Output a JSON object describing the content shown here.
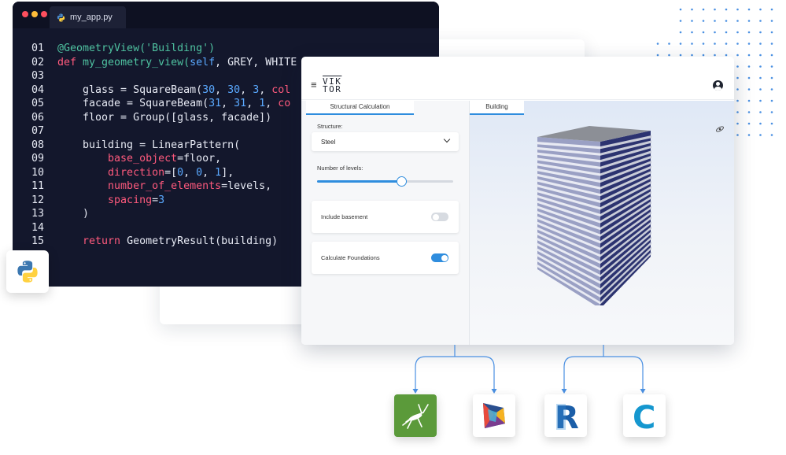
{
  "editor": {
    "filename": "my_app.py",
    "window_dots": [
      "#ff5f57",
      "#febc2e",
      "#28c840"
    ],
    "lines": [
      {
        "n": "01",
        "tokens": [
          [
            "dec",
            "@GeometryView("
          ],
          [
            "str",
            "'Building'"
          ],
          [
            "dec",
            ")"
          ]
        ]
      },
      {
        "n": "02",
        "tokens": [
          [
            "kw",
            "def "
          ],
          [
            "dec",
            "my_geometry_view("
          ],
          [
            "self",
            "self"
          ],
          [
            "txt",
            ", GREY, WHITE"
          ]
        ]
      },
      {
        "n": "03",
        "tokens": []
      },
      {
        "n": "04",
        "tokens": [
          [
            "txt",
            "    glass = SquareBeam("
          ],
          [
            "num",
            "30"
          ],
          [
            "txt",
            ", "
          ],
          [
            "num",
            "30"
          ],
          [
            "txt",
            ", "
          ],
          [
            "num",
            "3"
          ],
          [
            "txt",
            ", "
          ],
          [
            "prm",
            "col"
          ]
        ]
      },
      {
        "n": "05",
        "tokens": [
          [
            "txt",
            "    facade = SquareBeam("
          ],
          [
            "num",
            "31"
          ],
          [
            "txt",
            ", "
          ],
          [
            "num",
            "31"
          ],
          [
            "txt",
            ", "
          ],
          [
            "num",
            "1"
          ],
          [
            "txt",
            ", "
          ],
          [
            "prm",
            "co"
          ]
        ]
      },
      {
        "n": "06",
        "tokens": [
          [
            "txt",
            "    floor = Group([glass, facade])"
          ]
        ]
      },
      {
        "n": "07",
        "tokens": []
      },
      {
        "n": "08",
        "tokens": [
          [
            "txt",
            "    building = LinearPattern("
          ]
        ]
      },
      {
        "n": "09",
        "tokens": [
          [
            "prm",
            "        base_object"
          ],
          [
            "txt",
            "=floor,"
          ]
        ]
      },
      {
        "n": "10",
        "tokens": [
          [
            "prm",
            "        direction"
          ],
          [
            "txt",
            "=["
          ],
          [
            "num",
            "0"
          ],
          [
            "txt",
            ", "
          ],
          [
            "num",
            "0"
          ],
          [
            "txt",
            ", "
          ],
          [
            "num",
            "1"
          ],
          [
            "txt",
            "],"
          ]
        ]
      },
      {
        "n": "11",
        "tokens": [
          [
            "prm",
            "        number_of_elements"
          ],
          [
            "txt",
            "=levels,"
          ]
        ]
      },
      {
        "n": "12",
        "tokens": [
          [
            "prm",
            "        spacing"
          ],
          [
            "txt",
            "="
          ],
          [
            "num",
            "3"
          ]
        ]
      },
      {
        "n": "13",
        "tokens": [
          [
            "txt",
            "    )"
          ]
        ]
      },
      {
        "n": "14",
        "tokens": []
      },
      {
        "n": "15",
        "tokens": [
          [
            "kw",
            "    return "
          ],
          [
            "txt",
            "GeometryResult(building)"
          ]
        ]
      }
    ]
  },
  "app": {
    "logo_line1": "VIK",
    "logo_line2": "TOR",
    "tabs": {
      "left": "Structural Calculation",
      "right": "Building"
    },
    "structure": {
      "label": "Structure:",
      "value": "Steel"
    },
    "levels": {
      "label": "Number of levels:",
      "fraction": 0.62
    },
    "include_basement": {
      "label": "Include basement",
      "on": false
    },
    "calculate_foundations": {
      "label": "Calculate Foundations",
      "on": true
    },
    "accent": "#2f8dde"
  },
  "integrations": [
    {
      "name": "grasshopper-icon",
      "bg": "#5a9a3b"
    },
    {
      "name": "dynamo-icon",
      "bg": "#ffffff"
    },
    {
      "name": "revit-icon",
      "bg": "#ffffff",
      "letter": "R"
    },
    {
      "name": "civil3d-icon",
      "bg": "#ffffff",
      "letter": "C"
    }
  ]
}
